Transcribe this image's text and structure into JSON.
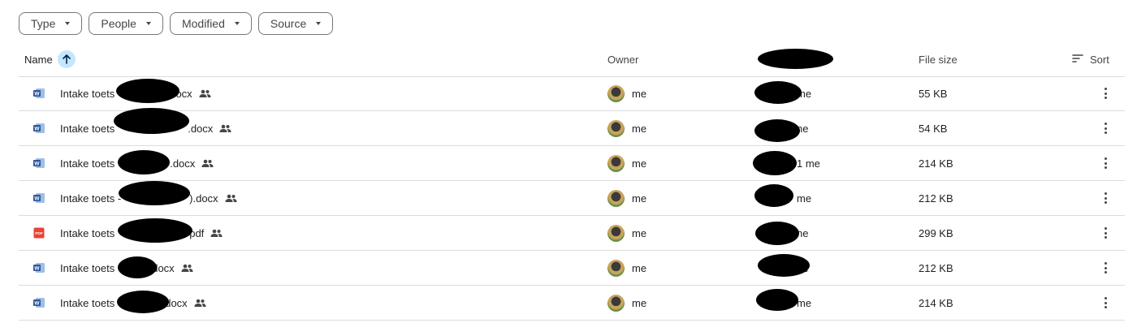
{
  "filters": [
    {
      "label": "Type"
    },
    {
      "label": "People"
    },
    {
      "label": "Modified"
    },
    {
      "label": "Source"
    }
  ],
  "columns": {
    "name": "Name",
    "owner": "Owner",
    "file_size": "File size",
    "sort": "Sort"
  },
  "colors": {
    "word_icon": "#2b579a",
    "pdf_icon": "#ea4335",
    "sort_active_bg": "#c2e7ff",
    "divider": "#dadce0"
  },
  "files": [
    {
      "name_prefix": "Intake toets",
      "name_suffix": "docx",
      "type": "word",
      "shared": true,
      "owner": "me",
      "modified_by": "me",
      "size": "55 KB"
    },
    {
      "name_prefix": "Intake toets",
      "name_suffix": ".docx",
      "type": "word",
      "shared": true,
      "owner": "me",
      "modified_by": "ne",
      "size": "54 KB"
    },
    {
      "name_prefix": "Intake toets",
      "name_suffix": ".docx",
      "type": "word",
      "shared": true,
      "owner": "me",
      "modified_by": "1 me",
      "size": "214 KB"
    },
    {
      "name_prefix": "Intake toets -",
      "name_suffix": ").docx",
      "type": "word",
      "shared": true,
      "owner": "me",
      "modified_by": "me",
      "size": "212 KB"
    },
    {
      "name_prefix": "Intake toets",
      "name_suffix": "pdf",
      "type": "pdf",
      "shared": true,
      "owner": "me",
      "modified_by": "ne",
      "size": "299 KB"
    },
    {
      "name_prefix": "Intake toets",
      "name_suffix": "docx",
      "type": "word",
      "shared": true,
      "owner": "me",
      "modified_by": "ne",
      "size": "212 KB"
    },
    {
      "name_prefix": "Intake toets",
      "name_suffix": "docx",
      "type": "word",
      "shared": true,
      "owner": "me",
      "modified_by": "me",
      "size": "214 KB"
    }
  ]
}
